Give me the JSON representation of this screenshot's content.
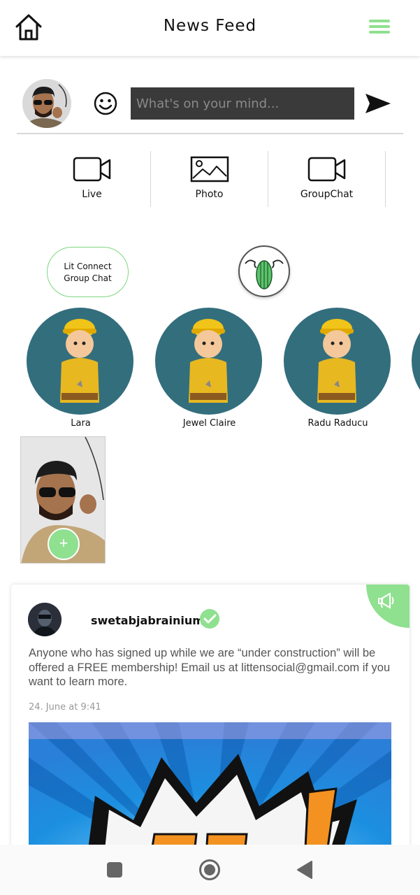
{
  "header": {
    "title": "News Feed",
    "home_icon": "home-icon",
    "menu_icon": "hamburger-menu-icon"
  },
  "composer": {
    "placeholder": "What's on your mind...",
    "emoji_icon": "smiley-icon",
    "send_icon": "send-icon"
  },
  "actions": [
    {
      "label": "Live",
      "icon": "video-camera-icon"
    },
    {
      "label": "Photo",
      "icon": "image-icon"
    },
    {
      "label": "GroupChat",
      "icon": "video-camera-icon"
    }
  ],
  "group_chat": {
    "line1": "Lit Connect",
    "line2": "Group Chat"
  },
  "people": [
    {
      "name": "Lara"
    },
    {
      "name": "Jewel Claire"
    },
    {
      "name": "Radu Raducu"
    }
  ],
  "story": {
    "add_label": "+"
  },
  "post": {
    "username": "swetabjabrainium",
    "text": "Anyone who has signed up while we are “under construction” will be offered a FREE membership! Email us at littensocial@gmail.com if you want to learn more.",
    "time": "24. June at 9:41",
    "corner_icon": "megaphone-icon",
    "verified_icon": "verified-check-icon"
  },
  "colors": {
    "accent": "#8fe08f",
    "avatar_bg": "#336e7d",
    "input_bg": "#3a3a3a"
  }
}
